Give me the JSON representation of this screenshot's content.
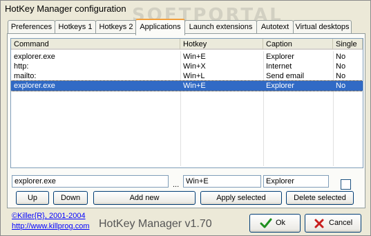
{
  "window": {
    "title": "HotKey Manager configuration"
  },
  "watermark": {
    "text": "SOFTPORTAL",
    "url": "www.softportal.com"
  },
  "tabs": [
    {
      "label": "Preferences"
    },
    {
      "label": "Hotkeys 1"
    },
    {
      "label": "Hotkeys 2"
    },
    {
      "label": "Applications"
    },
    {
      "label": "Launch extensions"
    },
    {
      "label": "Autotext"
    },
    {
      "label": "Virtual desktops"
    }
  ],
  "active_tab": "Applications",
  "list": {
    "columns": [
      "Command",
      "Hotkey",
      "Caption",
      "Single"
    ],
    "rows": [
      {
        "command": "explorer.exe",
        "hotkey": "Win+E",
        "caption": "Explorer",
        "single": "No"
      },
      {
        "command": "http:",
        "hotkey": "Win+X",
        "caption": "Internet",
        "single": "No"
      },
      {
        "command": "mailto:",
        "hotkey": "Win+L",
        "caption": "Send email",
        "single": "No"
      },
      {
        "command": "explorer.exe",
        "hotkey": "Win+E",
        "caption": "Explorer",
        "single": "No"
      }
    ],
    "selected_row": 3
  },
  "editor": {
    "command": "explorer.exe",
    "browse": "...",
    "hotkey": "Win+E",
    "caption": "Explorer",
    "single_checked": false
  },
  "buttons": {
    "up": "Up",
    "down": "Down",
    "add_new": "Add new",
    "apply_selected": "Apply selected",
    "delete_selected": "Delete selected",
    "ok": "Ok",
    "cancel": "Cancel"
  },
  "footer": {
    "copyright": "©Killer{R}, 2001-2004",
    "website": "http://www.killprog.com",
    "product": "HotKey Manager v1.70"
  },
  "colors": {
    "selection": "#316ac5",
    "ok_check": "#1f8f1f",
    "cancel_x": "#c81e1e"
  }
}
